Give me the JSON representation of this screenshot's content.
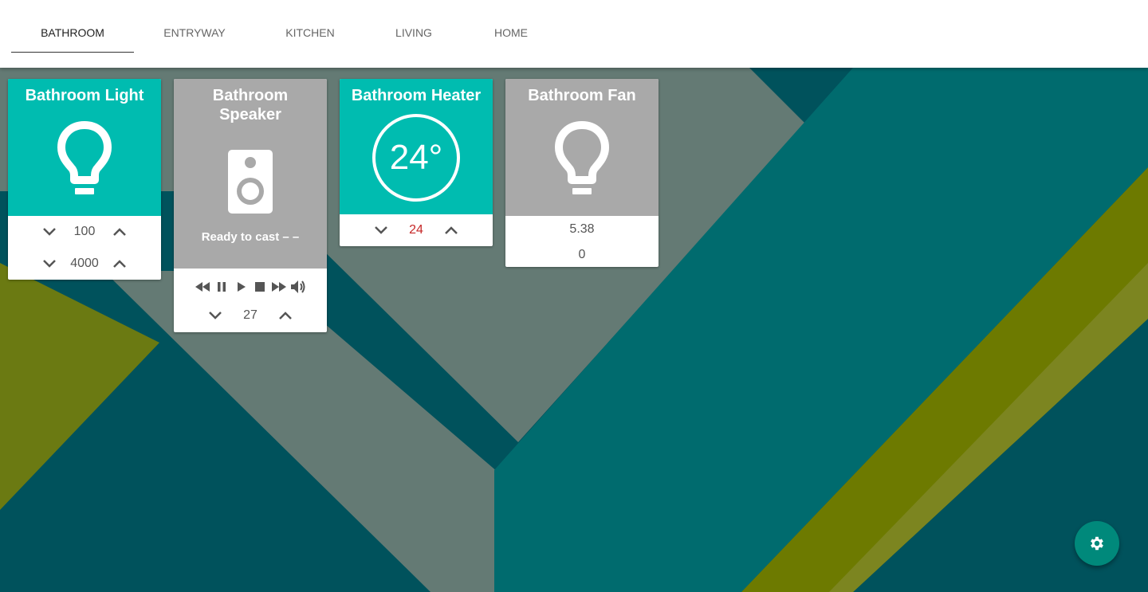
{
  "tabs": [
    {
      "label": "BATHROOM",
      "active": true
    },
    {
      "label": "ENTRYWAY",
      "active": false
    },
    {
      "label": "KITCHEN",
      "active": false
    },
    {
      "label": "LIVING",
      "active": false
    },
    {
      "label": "HOME",
      "active": false
    }
  ],
  "cards": {
    "light": {
      "title": "Bathroom Light",
      "icon": "lightbulb-icon",
      "brightness": "100",
      "color_temp": "4000"
    },
    "speaker": {
      "title": "Bathroom Speaker",
      "icon": "speaker-icon",
      "status": "Ready to cast – –",
      "volume": "27"
    },
    "heater": {
      "title": "Bathroom Heater",
      "current_temp": "24°",
      "target_temp": "24"
    },
    "fan": {
      "title": "Bathroom Fan",
      "icon": "lightbulb-icon",
      "value1": "5.38",
      "value2": "0"
    }
  },
  "settings_button": {
    "icon": "gear-icon"
  },
  "colors": {
    "active_tile": "#00bcb0",
    "inactive_tile": "#a9a9a9",
    "target_temp": "#c62828",
    "fab": "#00897b"
  }
}
